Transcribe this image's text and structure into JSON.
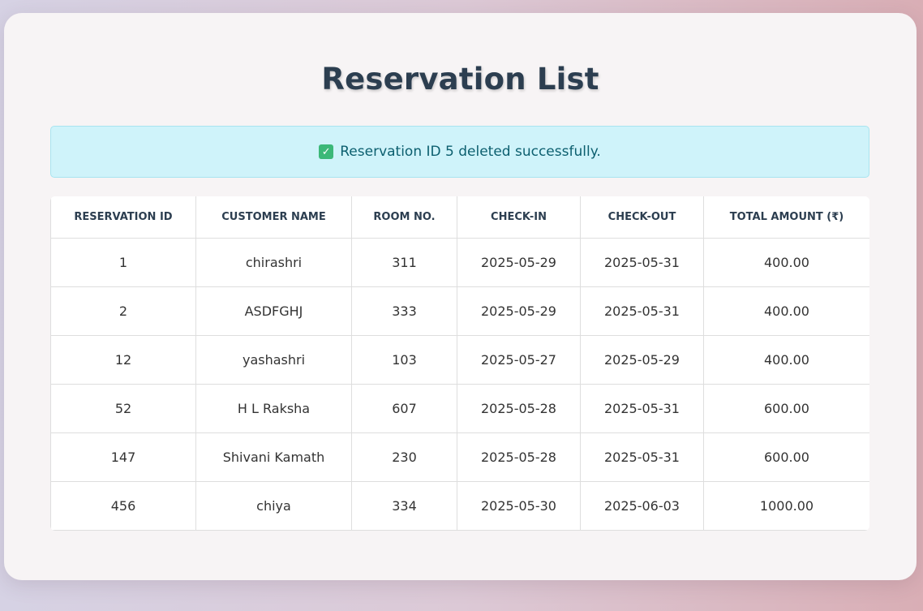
{
  "page": {
    "title": "Reservation List"
  },
  "alert": {
    "icon": "check-mark-icon",
    "icon_glyph": "✓",
    "message": "Reservation ID 5 deleted successfully."
  },
  "table": {
    "headers": [
      "RESERVATION ID",
      "CUSTOMER NAME",
      "ROOM NO.",
      "CHECK-IN",
      "CHECK-OUT",
      "TOTAL AMOUNT (₹)"
    ],
    "rows": [
      [
        "1",
        "chirashri",
        "311",
        "2025-05-29",
        "2025-05-31",
        "400.00"
      ],
      [
        "2",
        "ASDFGHJ",
        "333",
        "2025-05-29",
        "2025-05-31",
        "400.00"
      ],
      [
        "12",
        "yashashri",
        "103",
        "2025-05-27",
        "2025-05-29",
        "400.00"
      ],
      [
        "52",
        "H L Raksha",
        "607",
        "2025-05-28",
        "2025-05-31",
        "600.00"
      ],
      [
        "147",
        "Shivani Kamath",
        "230",
        "2025-05-28",
        "2025-05-31",
        "600.00"
      ],
      [
        "456",
        "chiya",
        "334",
        "2025-05-30",
        "2025-06-03",
        "1000.00"
      ]
    ]
  },
  "colors": {
    "title": "#2c3e50",
    "alert_bg": "#cff3fa",
    "alert_text": "#0c5f6f",
    "check_icon": "#3cb878"
  }
}
